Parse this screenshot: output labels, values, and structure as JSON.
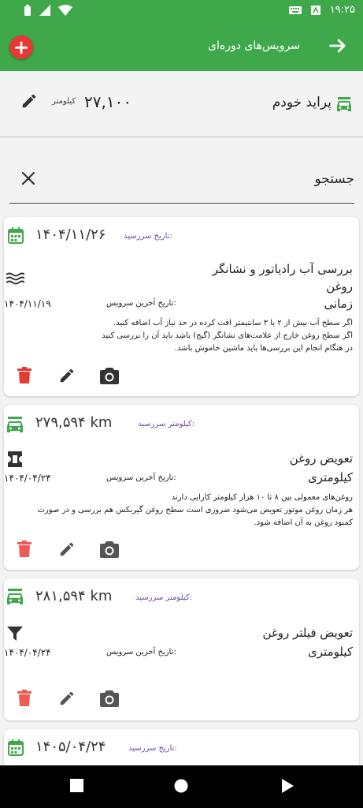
{
  "status_bar": {
    "time": "۱۹:۲۵"
  },
  "app_bar": {
    "title": "سرویس‌های دوره‌ای"
  },
  "car": {
    "name": "پراید خودم",
    "odometer": "۲۷,۱۰۰",
    "odometer_unit": "کیلومتر"
  },
  "search": {
    "placeholder": "جستجو",
    "value": ""
  },
  "services": [
    {
      "due_label": "تاریخ سررسید:",
      "due_value": "۱۴۰۴/۱۱/۲۶",
      "due_type": "date",
      "type_icon": "radiator-icon",
      "name_lines": [
        "بررسی آب رادیاتور و نشانگر",
        "روغن",
        "زمانی"
      ],
      "last_service_label": "تاریخ آخرین سرویس:",
      "last_service_value": "۱۴۰۴/۱۱/۱۹",
      "description": [
        "اگر سطح آب بیش از ۲ یا ۳ سانتیمتر افت کرده در حد نیاز آب اضافه کنید.",
        "اگر سطح روغن خارج از علامت‌های نشانگر (گیج) باشد باید آن را بررسی کنید",
        "در هنگام انجام این بررسی‌ها باید ماشین خاموش باشد."
      ]
    },
    {
      "due_label": "کیلومتر سررسید:",
      "due_value": "۲۷۹,۵۹۴ km",
      "due_type": "km",
      "type_icon": "oil-can-icon",
      "name_lines": [
        "تعویض روغن",
        "کیلومتری"
      ],
      "last_service_label": "تاریخ آخرین سرویس:",
      "last_service_value": "۱۴۰۴/۰۴/۲۴",
      "description": [
        "روغن‌های معمولی بین ۸ تا ۱۰ هزار کیلومتر کارایی دارند",
        "هر زمان روغن موتور تعویض می‌شود ضروری است سطح روغن گیربکس هم بررسی و در صورت",
        "کمبود روغن به آن اضافه شود."
      ]
    },
    {
      "due_label": "کیلومتر سررسید:",
      "due_value": "۲۸۱,۵۹۴ km",
      "due_type": "km",
      "type_icon": "filter-icon",
      "name_lines": [
        "تعویض فیلتر روغن",
        "کیلومتری"
      ],
      "last_service_label": "تاریخ آخرین سرویس:",
      "last_service_value": "۱۴۰۴/۰۴/۲۴",
      "description": []
    },
    {
      "due_label": "تاریخ سررسید:",
      "due_value": "۱۴۰۵/۰۴/۲۴",
      "due_type": "date"
    }
  ],
  "colors": {
    "primary": "#3fa84b",
    "delete": "#e53935",
    "label_purple": "#6a4c9c",
    "text": "#222222"
  }
}
